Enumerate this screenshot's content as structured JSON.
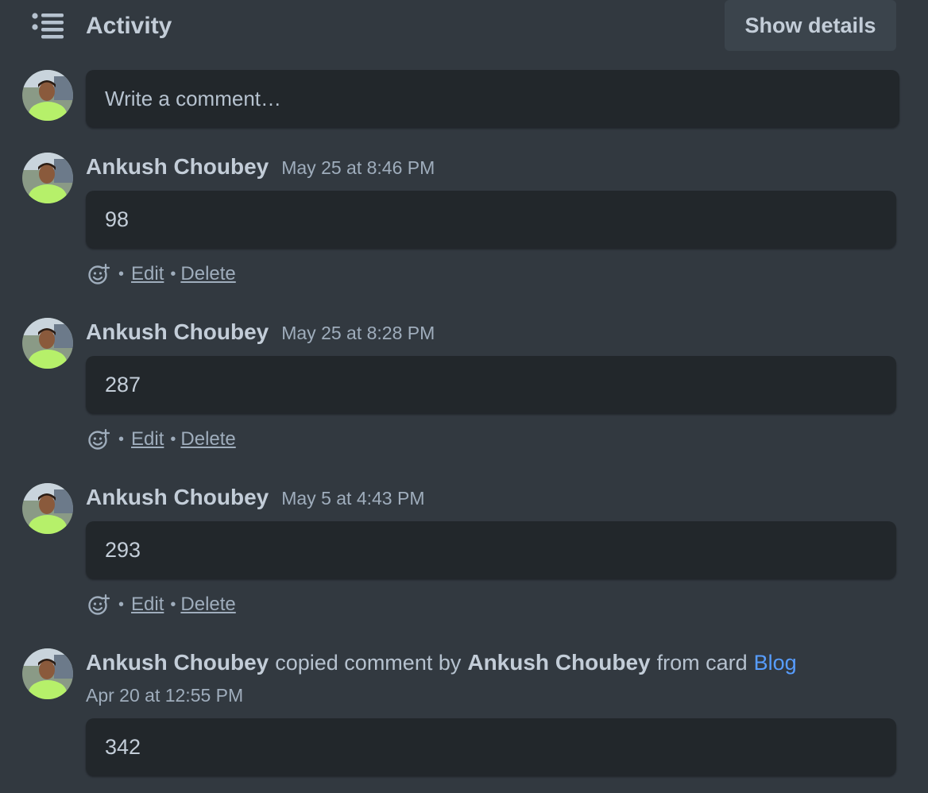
{
  "header": {
    "title": "Activity",
    "show_details_label": "Show details",
    "icon": "list-icon"
  },
  "composer": {
    "placeholder": "Write a comment…"
  },
  "comments": [
    {
      "author": "Ankush Choubey",
      "time": "May 25 at 8:46 PM",
      "text": "98",
      "edit_label": "Edit",
      "delete_label": "Delete"
    },
    {
      "author": "Ankush Choubey",
      "time": "May 25 at 8:28 PM",
      "text": "287",
      "edit_label": "Edit",
      "delete_label": "Delete"
    },
    {
      "author": "Ankush Choubey",
      "time": "May 5 at 4:43 PM",
      "text": "293",
      "edit_label": "Edit",
      "delete_label": "Delete"
    }
  ],
  "copied_entry": {
    "actor": "Ankush Choubey",
    "action_text": "copied comment by",
    "original_author": "Ankush Choubey",
    "from_text": "from card",
    "card_name": "Blog",
    "time": "Apr 20 at 12:55 PM",
    "text": "342"
  },
  "colors": {
    "background": "#323940",
    "surface": "#22272b",
    "link": "#579dff",
    "text": "#b6c2cf"
  }
}
